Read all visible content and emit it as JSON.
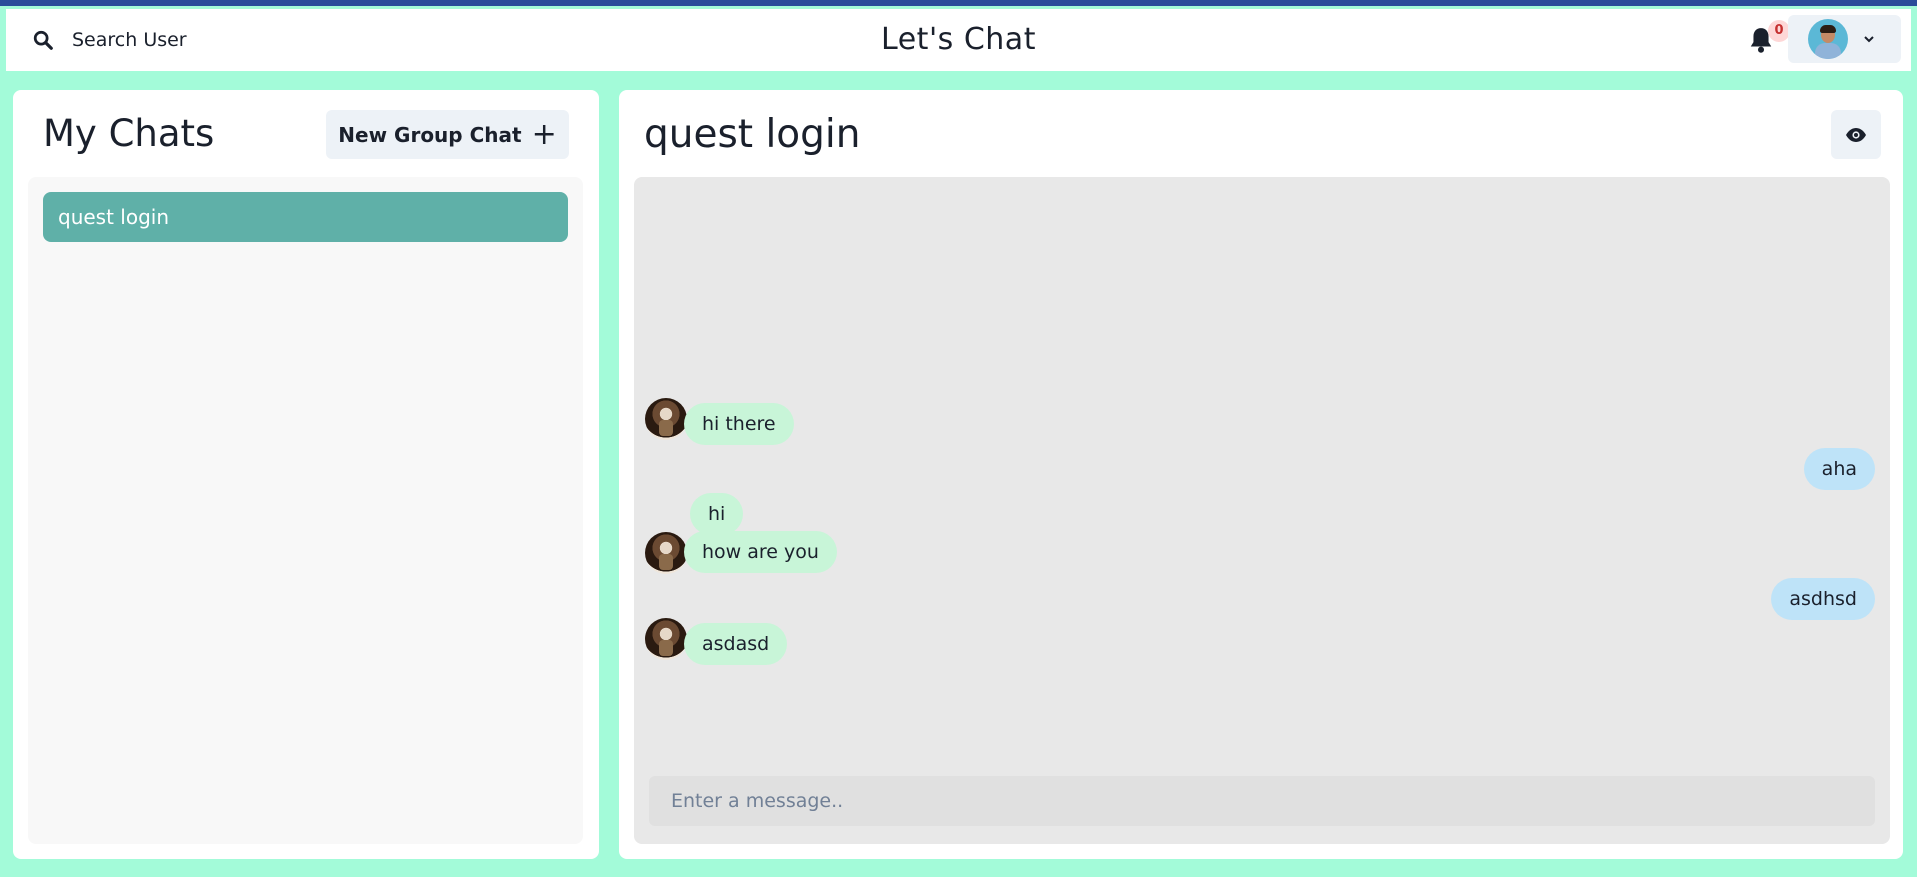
{
  "header": {
    "search_label": "Search User",
    "app_title": "Let's Chat",
    "notification_count": "0"
  },
  "sidebar": {
    "title": "My Chats",
    "new_group_label": "New Group Chat",
    "new_group_icon": "+",
    "chats": [
      {
        "name": "quest login",
        "selected": true
      }
    ]
  },
  "chat": {
    "title": "quest login",
    "messages": [
      {
        "text": "hi there",
        "direction": "incoming",
        "show_avatar": true
      },
      {
        "text": "aha",
        "direction": "outgoing",
        "show_avatar": false
      },
      {
        "text": "hi",
        "direction": "incoming",
        "show_avatar": false
      },
      {
        "text": "how are you",
        "direction": "incoming",
        "show_avatar": true
      },
      {
        "text": "asdhsd",
        "direction": "outgoing",
        "show_avatar": false
      },
      {
        "text": "asdasd",
        "direction": "incoming",
        "show_avatar": true
      }
    ],
    "input_placeholder": "Enter a message..",
    "input_value": ""
  },
  "colors": {
    "page_background": "#a3fbd9",
    "selected_chat": "#5fb0a8",
    "incoming_bubble": "#c8f5d8",
    "outgoing_bubble": "#bee3f8",
    "top_accent": "#2a4c9a"
  },
  "icons": {
    "search": "search-icon",
    "notifications": "bell-icon",
    "profile_menu": "chevron-down-icon",
    "view_profile": "eye-icon",
    "new_group": "plus-icon"
  }
}
